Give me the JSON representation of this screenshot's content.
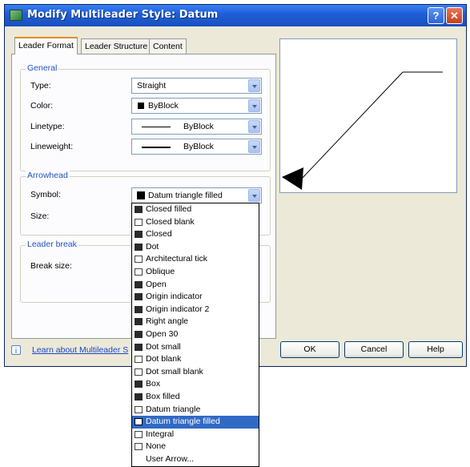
{
  "window": {
    "title": "Modify Multileader Style: Datum",
    "help_glyph": "?",
    "close_glyph": "✕"
  },
  "tabs": [
    {
      "label": "Leader Format",
      "active": true
    },
    {
      "label": "Leader Structure",
      "active": false
    },
    {
      "label": "Content",
      "active": false
    }
  ],
  "general": {
    "title": "General",
    "type": {
      "label": "Type:",
      "value": "Straight"
    },
    "color": {
      "label": "Color:",
      "value": "ByBlock"
    },
    "linetype": {
      "label": "Linetype:",
      "value": "ByBlock"
    },
    "lineweight": {
      "label": "Lineweight:",
      "value": "ByBlock"
    }
  },
  "arrowhead": {
    "title": "Arrowhead",
    "symbol": {
      "label": "Symbol:",
      "value": "Datum triangle filled"
    },
    "size": {
      "label": "Size:"
    }
  },
  "leader_break": {
    "title": "Leader break",
    "break_size_label": "Break size:"
  },
  "help_link": {
    "icon": "i",
    "text": "Learn about Multileader S"
  },
  "buttons": {
    "ok": "OK",
    "cancel": "Cancel",
    "help": "Help"
  },
  "symbol_options": [
    {
      "label": "Closed filled",
      "icon": "closed-filled-icon"
    },
    {
      "label": "Closed blank",
      "icon": "closed-blank-icon"
    },
    {
      "label": "Closed",
      "icon": "closed-icon"
    },
    {
      "label": "Dot",
      "icon": "dot-icon"
    },
    {
      "label": "Architectural tick",
      "icon": "architectural-tick-icon"
    },
    {
      "label": "Oblique",
      "icon": "oblique-icon"
    },
    {
      "label": "Open",
      "icon": "open-icon"
    },
    {
      "label": "Origin indicator",
      "icon": "origin-indicator-icon"
    },
    {
      "label": "Origin indicator 2",
      "icon": "origin-indicator-2-icon"
    },
    {
      "label": "Right angle",
      "icon": "right-angle-icon"
    },
    {
      "label": "Open 30",
      "icon": "open-30-icon"
    },
    {
      "label": "Dot small",
      "icon": "dot-small-icon"
    },
    {
      "label": "Dot blank",
      "icon": "dot-blank-icon"
    },
    {
      "label": "Dot small blank",
      "icon": "dot-small-blank-icon"
    },
    {
      "label": "Box",
      "icon": "box-icon"
    },
    {
      "label": "Box filled",
      "icon": "box-filled-icon"
    },
    {
      "label": "Datum triangle",
      "icon": "datum-triangle-icon"
    },
    {
      "label": "Datum triangle filled",
      "icon": "datum-triangle-filled-icon",
      "selected": true
    },
    {
      "label": "Integral",
      "icon": "integral-icon"
    },
    {
      "label": "None",
      "icon": "none-icon"
    },
    {
      "label": "User Arrow...",
      "icon": ""
    }
  ],
  "colors": {
    "title_bar": "#1f5fd8",
    "dialog_bg": "#ece9d8",
    "group_title": "#2050c0",
    "selection": "#316ac5",
    "link": "#1a46c6"
  }
}
